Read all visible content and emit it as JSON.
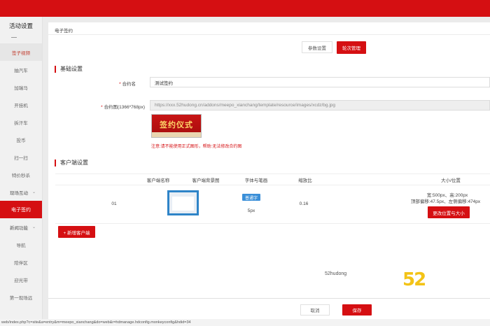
{
  "sidebar": {
    "title": "活动设置",
    "items": [
      {
        "label": "签子视频"
      },
      {
        "label": "抽汽车"
      },
      {
        "label": "加瑞马"
      },
      {
        "label": "开挂机"
      },
      {
        "label": "拆汗车"
      },
      {
        "label": "投币"
      },
      {
        "label": "扫一扫"
      },
      {
        "label": "特价秒杀"
      }
    ],
    "group1": "现场互动",
    "active": "电子签约",
    "group2": "新闻功能",
    "items2": [
      {
        "label": "导航"
      },
      {
        "label": "陪伴区"
      },
      {
        "label": "迎光带"
      },
      {
        "label": "第一现场远"
      }
    ]
  },
  "breadcrumb": "电子签约",
  "top_buttons": {
    "params": "参数设置",
    "rounds": "轮次管理"
  },
  "basic": {
    "title": "基础设置",
    "name_label": "合约名",
    "name_value": "测试签约",
    "image_label": "合约图(1366*768px)",
    "image_url": "https://xxx.52hudong.cn/addons/meepo_xianchang/template/resource/images/xcdz/bg.jpg",
    "sign_text": "签约仪式",
    "warning": "注意:请不能使用正式图形，帮助:无法修改合约图"
  },
  "client": {
    "title": "客户端设置",
    "columns": [
      "客户端名称",
      "客户端背景图",
      "字体与笔画",
      "缩放比",
      "大小/位置"
    ],
    "rows": [
      {
        "name": "01",
        "font_badge": "普通字",
        "stroke": "5px",
        "scale": "0.16",
        "size_line1": "宽:500px、高:200px",
        "size_line2": "顶部偏移:47.5px、左侧偏移:474px",
        "change_button": "更改位置与大小"
      }
    ],
    "add_button": "+ 新增客户端"
  },
  "watermark": "52hudong",
  "logo_text": "52",
  "footer": {
    "cancel": "取消",
    "save": "保存"
  },
  "status_url": "web/index.php?c=site&a=entry&m=meepo_xianchang&do=web&r=hdmanage.hdconfig.monkeyconfig&hdid=34",
  "colors": {
    "brand_red": "#d50f12",
    "badge_blue": "#3a8fd8",
    "logo_yellow": "#f3c317"
  }
}
